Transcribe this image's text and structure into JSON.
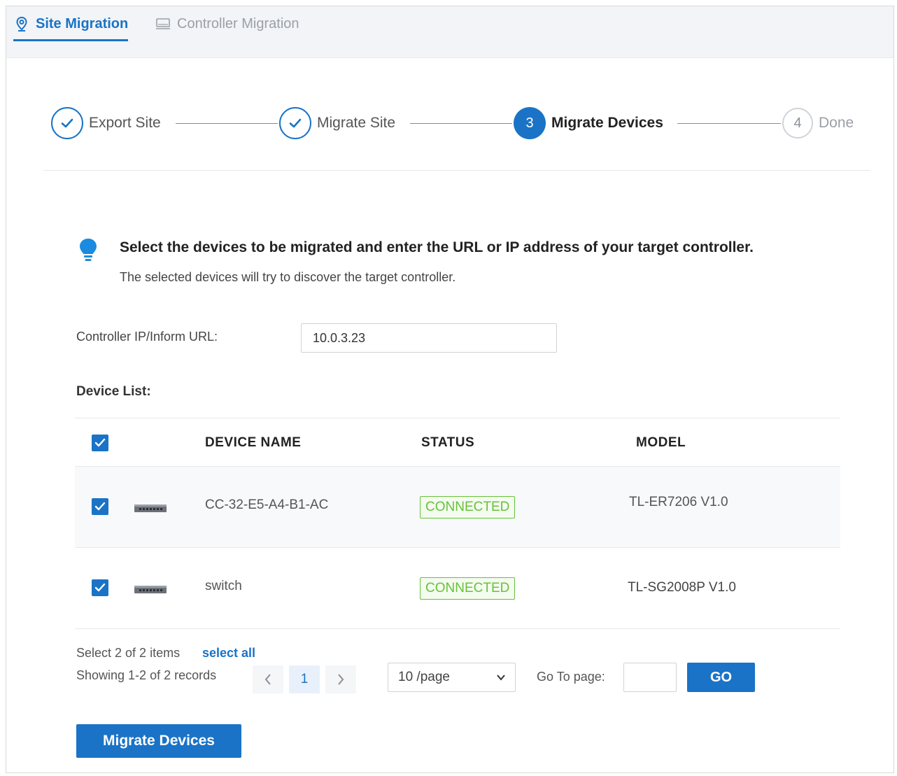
{
  "tabs": [
    {
      "label": "Site Migration",
      "active": true
    },
    {
      "label": "Controller Migration",
      "active": false
    }
  ],
  "stepper": {
    "steps": [
      {
        "label": "Export Site",
        "state": "done"
      },
      {
        "label": "Migrate Site",
        "state": "done"
      },
      {
        "number": "3",
        "label": "Migrate Devices",
        "state": "active"
      },
      {
        "number": "4",
        "label": "Done",
        "state": "todo"
      }
    ]
  },
  "info": {
    "headline": "Select the devices to be migrated and enter the URL or IP address of your target controller.",
    "subline": "The selected devices will try to discover the target controller."
  },
  "controller_field": {
    "label": "Controller IP/Inform URL:",
    "value": "10.0.3.23"
  },
  "device_list": {
    "label": "Device List:",
    "columns": [
      "DEVICE NAME",
      "STATUS",
      "MODEL"
    ],
    "rows": [
      {
        "name": "CC-32-E5-A4-B1-AC",
        "status": "CONNECTED",
        "model": "TL-ER7206 V1.0",
        "checked": true
      },
      {
        "name": "switch",
        "status": "CONNECTED",
        "model": "TL-SG2008P V1.0",
        "checked": true
      }
    ]
  },
  "pagination": {
    "select_info": "Select 2 of 2 items",
    "select_all": "select all",
    "showing": "Showing 1-2 of 2 records",
    "current_page": "1",
    "page_size": "10 /page",
    "goto_label": "Go To page:",
    "go_label": "GO"
  },
  "actions": {
    "migrate_label": "Migrate Devices"
  },
  "colors": {
    "accent": "#1a73c6",
    "connected": "#67c23a"
  }
}
